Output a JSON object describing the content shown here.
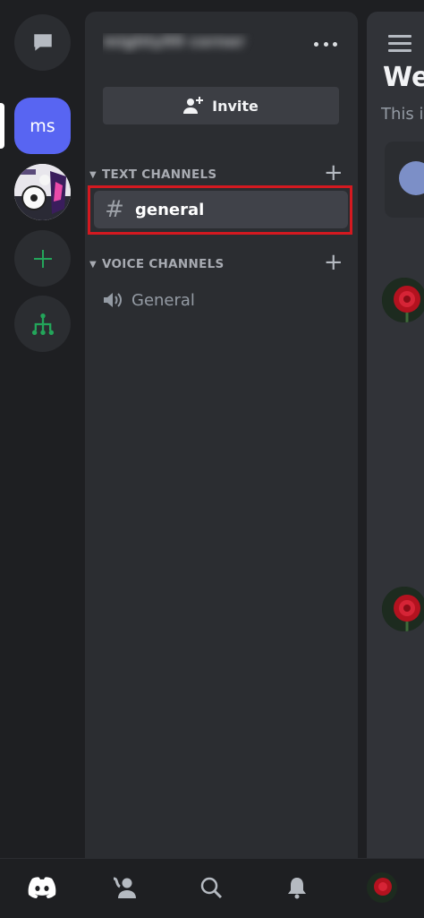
{
  "servers": {
    "active_server_label": "ms"
  },
  "sidebar": {
    "server_name": "mighty99 corner",
    "invite_label": "Invite",
    "categories": [
      {
        "label": "TEXT CHANNELS",
        "channels": [
          {
            "label": "general",
            "icon": "hash-icon",
            "selected": true
          }
        ]
      },
      {
        "label": "VOICE CHANNELS",
        "channels": [
          {
            "label": "General",
            "icon": "speaker-icon",
            "selected": false
          }
        ]
      }
    ]
  },
  "main": {
    "welcome_fragment": "We",
    "subtitle_fragment": "This i"
  },
  "colors": {
    "accent": "#5865f2",
    "highlight_box": "#d41920",
    "add_server_green": "#23a55a"
  },
  "bottom_nav": [
    "home-icon",
    "friends-icon",
    "search-icon",
    "bell-icon",
    "profile-avatar"
  ]
}
